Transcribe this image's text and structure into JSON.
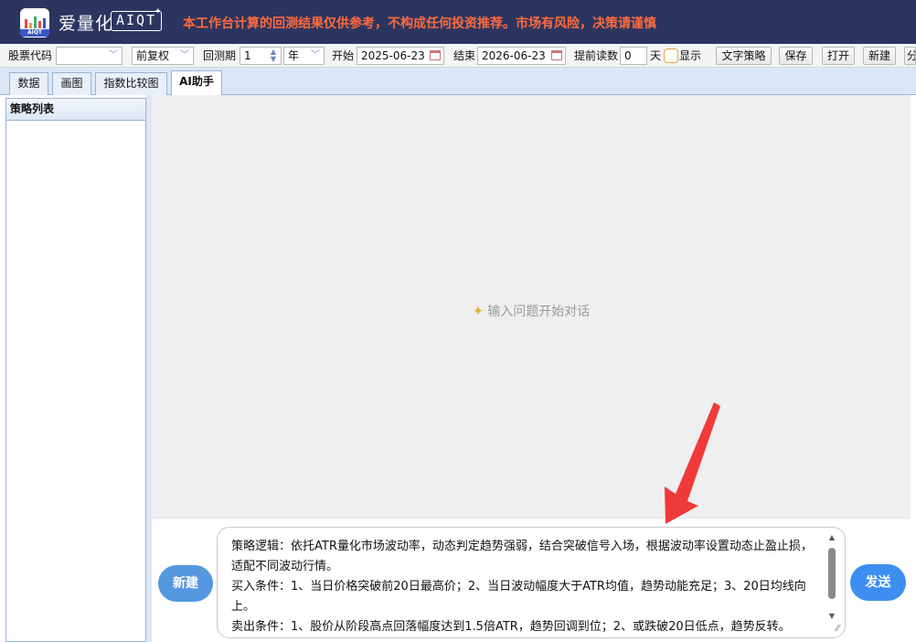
{
  "header": {
    "brand_name": "爱量化",
    "brand_tag": "AIQT",
    "logo_text": "AIQT",
    "notice": "本工作台计算的回测结果仅供参考，不构成任何投资推荐。市场有风险，决策请谨慎"
  },
  "toolbar": {
    "stock_code_label": "股票代码",
    "stock_code_value": "",
    "adjust_value": "前复权",
    "period_label": "回测期",
    "period_value": "1",
    "period_unit": "年",
    "start_label": "开始",
    "start_date": "2025-06-23",
    "end_label": "结束",
    "end_date": "2026-06-23",
    "preload_label": "提前读数",
    "preload_value": "0",
    "preload_unit": "天",
    "show_label": "显示",
    "btn_text_strategy": "文字策略",
    "btn_save": "保存",
    "btn_open": "打开",
    "btn_new": "新建",
    "btn_cut": "分"
  },
  "tabs": [
    {
      "label": "数据",
      "active": false
    },
    {
      "label": "画图",
      "active": false
    },
    {
      "label": "指数比较图",
      "active": false
    },
    {
      "label": "AI助手",
      "active": true
    }
  ],
  "sidebar": {
    "title": "策略列表"
  },
  "chat": {
    "empty_hint": "输入问题开始对话",
    "new_button": "新建",
    "send_button": "发送",
    "input_text": "策略逻辑：依托ATR量化市场波动率，动态判定趋势强弱，结合突破信号入场，根据波动率设置动态止盈止损，适配不同波动行情。\n买入条件：1、当日价格突破前20日最高价；2、当日波动幅度大于ATR均值，趋势动能充足；3、20日均线向上。\n卖出条件：1、股价从阶段高点回落幅度达到1.5倍ATR，趋势回调到位；2、或跌破20日低点，趋势反转。"
  },
  "colors": {
    "header_bg": "#2b3560",
    "notice": "#ff6a3c",
    "send_button": "#3d8ef0",
    "new_button": "#5598e0",
    "arrow": "#f03a3a"
  }
}
